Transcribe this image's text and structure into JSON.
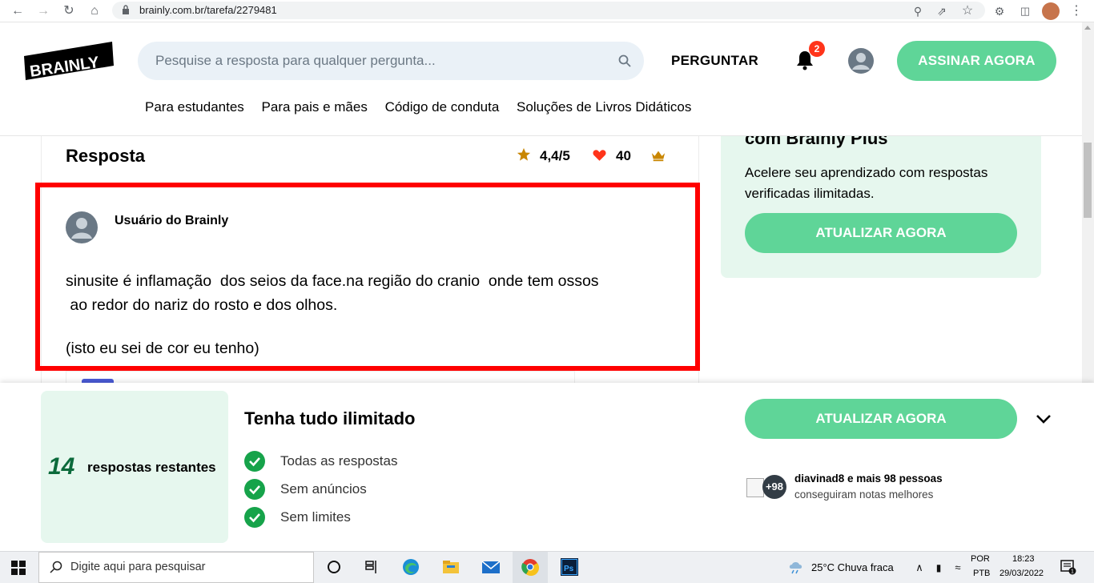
{
  "browser": {
    "url": "brainly.com.br/tarefa/2279481"
  },
  "header": {
    "logo_text": "BRAINLY",
    "search_placeholder": "Pesquise a resposta para qualquer pergunta...",
    "ask_label": "PERGUNTAR",
    "notification_count": "2",
    "subscribe_label": "ASSINAR AGORA",
    "nav": [
      "Para estudantes",
      "Para pais e mães",
      "Código de conduta",
      "Soluções de Livros Didáticos"
    ]
  },
  "answer": {
    "title": "Resposta",
    "rating": "4,4/5",
    "likes": "40",
    "author": "Usuário do Brainly",
    "text_line1": "sinusite é inflamação  dos seios da face.na região do cranio  onde tem ossos",
    "text_line2": " ao redor do nariz do rosto e dos olhos.",
    "text_line3": "(isto eu sei de cor eu tenho)"
  },
  "sidebar": {
    "title": "com Brainly Plus",
    "text": "Acelere seu aprendizado com respostas verificadas ilimitadas.",
    "button": "ATUALIZAR AGORA"
  },
  "bottom": {
    "count": "14",
    "count_label": "respostas restantes",
    "title": "Tenha tudo ilimitado",
    "features": [
      "Todas as respostas",
      "Sem anúncios",
      "Sem limites"
    ],
    "button": "ATUALIZAR AGORA",
    "social_badge": "+98",
    "social_line1": "diavinad8 e mais 98 pessoas",
    "social_line2": "conseguiram notas melhores"
  },
  "taskbar": {
    "search_placeholder": "Digite aqui para pesquisar",
    "weather": "25°C  Chuva fraca",
    "lang1": "POR",
    "lang2": "PTB",
    "time": "18:23",
    "date": "29/03/2022"
  },
  "colors": {
    "brand_green": "#5fd598",
    "light_green": "#e6f7ee",
    "highlight_red": "#ff0000",
    "badge_red": "#ff341a"
  }
}
